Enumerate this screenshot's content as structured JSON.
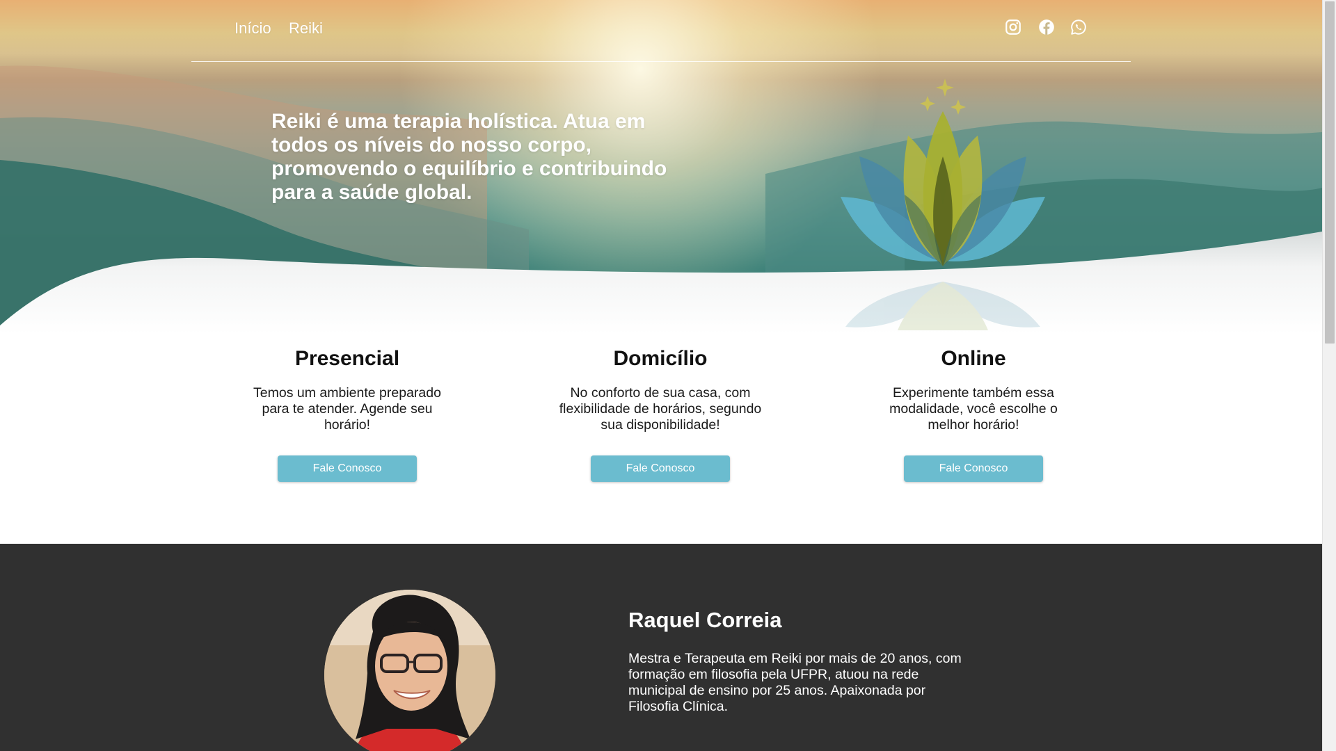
{
  "nav": {
    "links": [
      {
        "label": "Início"
      },
      {
        "label": "Reiki"
      }
    ],
    "social_icons": [
      "instagram-icon",
      "facebook-icon",
      "whatsapp-icon"
    ]
  },
  "hero": {
    "headline": "Reiki é uma terapia holística. Atua em todos os níveis do nosso corpo, promovendo o equilíbrio e contribuindo para a saúde global.",
    "logo_icon": "lotus-icon"
  },
  "services": [
    {
      "title": "Presencial",
      "description": "Temos um ambiente preparado para te atender. Agende seu horário!",
      "button": "Fale Conosco"
    },
    {
      "title": "Domicílio",
      "description": "No conforto de sua casa, com flexibilidade de horários, segundo sua disponibilidade!",
      "button": "Fale Conosco"
    },
    {
      "title": "Online",
      "description": "Experimente também essa modalidade, você escolhe o melhor horário!",
      "button": "Fale Conosco"
    }
  ],
  "profile": {
    "name": "Raquel Correia",
    "bio": "Mestra e Terapeuta em Reiki por mais de 20 anos, com formação em filosofia pela UFPR, atuou na rede municipal de ensino por 25 anos. Apaixonada por Filosofia Clínica."
  },
  "colors": {
    "button": "#6bbccf",
    "profile_bg": "#303030",
    "hero_teal": "#2f7a73",
    "hero_gold": "#e8b073"
  }
}
